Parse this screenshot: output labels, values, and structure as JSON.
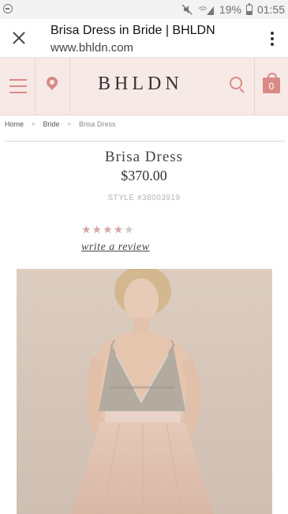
{
  "statusbar": {
    "battery": "19%",
    "time": "01:55"
  },
  "browser": {
    "title": "Brisa Dress in Bride | BHLDN",
    "url": "www.bhldn.com"
  },
  "header": {
    "logo": "BHLDN",
    "cart_count": "0",
    "colors": {
      "background": "#f7e9e6",
      "accent": "#d98a86"
    }
  },
  "breadcrumb": {
    "items": [
      "Home",
      "Bride",
      "Brisa Dress"
    ]
  },
  "product": {
    "name": "Brisa Dress",
    "price": "$370.00",
    "style": "STYLE #38003919",
    "rating_stars": 4,
    "rating_max": 5,
    "review_link": "write a review",
    "image_icon": "product-photo"
  }
}
